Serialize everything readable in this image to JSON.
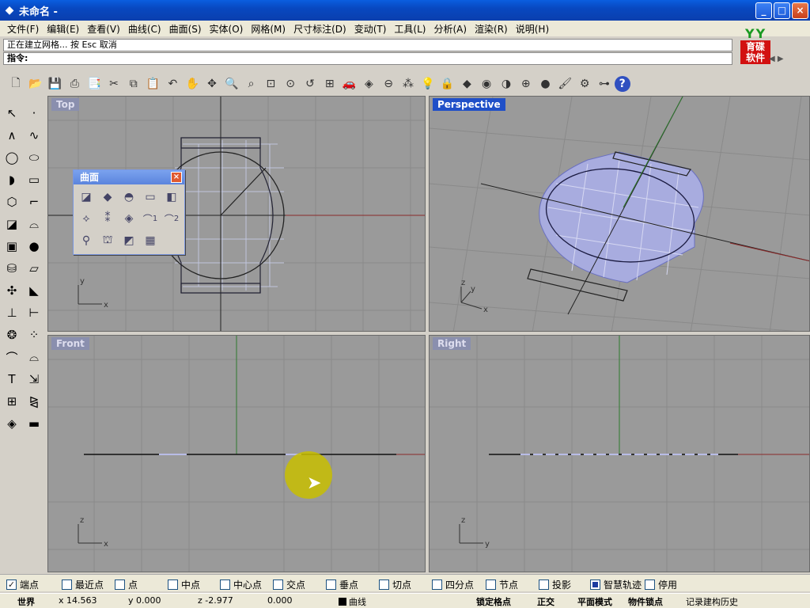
{
  "window": {
    "title": "未命名 -",
    "minimize": "_",
    "maximize": "□",
    "close": "×"
  },
  "menu": [
    "文件(F)",
    "编辑(E)",
    "查看(V)",
    "曲线(C)",
    "曲面(S)",
    "实体(O)",
    "网格(M)",
    "尺寸标注(D)",
    "变动(T)",
    "工具(L)",
    "分析(A)",
    "渲染(R)",
    "说明(H)"
  ],
  "command": {
    "history": "正在建立网格... 按 Esc 取消",
    "prompt": "指令:"
  },
  "logo": {
    "text_line1": "育碟",
    "text_line2": "软件",
    "leaf": "YY"
  },
  "viewports": {
    "top": "Top",
    "perspective": "Perspective",
    "front": "Front",
    "right": "Right"
  },
  "axis_labels": {
    "x": "x",
    "y": "y",
    "z": "z"
  },
  "palette": {
    "title": "曲面",
    "close": "×",
    "n1": "1",
    "n2": "2"
  },
  "snaps": [
    {
      "label": "端点",
      "checked": true
    },
    {
      "label": "最近点",
      "checked": false
    },
    {
      "label": "点",
      "checked": false
    },
    {
      "label": "中点",
      "checked": false
    },
    {
      "label": "中心点",
      "checked": false
    },
    {
      "label": "交点",
      "checked": false
    },
    {
      "label": "垂点",
      "checked": false
    },
    {
      "label": "切点",
      "checked": false
    },
    {
      "label": "四分点",
      "checked": false
    },
    {
      "label": "节点",
      "checked": false
    },
    {
      "label": "投影",
      "checked": false
    },
    {
      "label": "智慧轨迹",
      "checked": true
    },
    {
      "label": "停用",
      "checked": false
    }
  ],
  "status": {
    "cplane": "世界",
    "x": "x 14.563",
    "y": "y 0.000",
    "z": "z -2.977",
    "dist": "0.000",
    "layer": "曲线",
    "grid_snap": "锁定格点",
    "ortho": "正交",
    "planar": "平面模式",
    "osnap": "物件锁点",
    "history": "记录建构历史"
  },
  "colors": {
    "layer_swatch": "#000000",
    "active_viewport": "#2050c8"
  }
}
